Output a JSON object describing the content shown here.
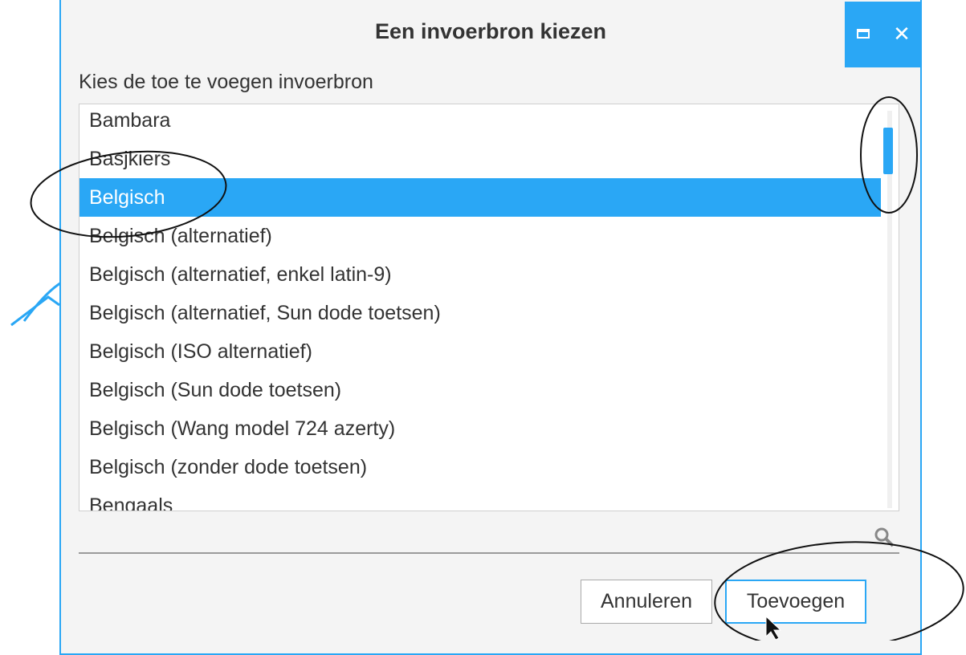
{
  "dialog": {
    "title": "Een invoerbron kiezen",
    "prompt": "Kies de toe te voegen invoerbron",
    "items": [
      "Bambara",
      "Basjkiers",
      "Belgisch",
      "Belgisch (alternatief)",
      "Belgisch (alternatief, enkel latin-9)",
      "Belgisch (alternatief, Sun dode toetsen)",
      "Belgisch (ISO alternatief)",
      "Belgisch (Sun dode toetsen)",
      "Belgisch (Wang model 724 azerty)",
      "Belgisch (zonder dode toetsen)",
      "Bengaals"
    ],
    "selected_index": 2,
    "search": {
      "value": ""
    },
    "buttons": {
      "cancel": "Annuleren",
      "add": "Toevoegen"
    }
  },
  "colors": {
    "accent": "#2aa7f5",
    "background": "#f4f4f4"
  },
  "icons": [
    "maximize-icon",
    "close-icon",
    "search-icon",
    "mouse-cursor-icon"
  ]
}
